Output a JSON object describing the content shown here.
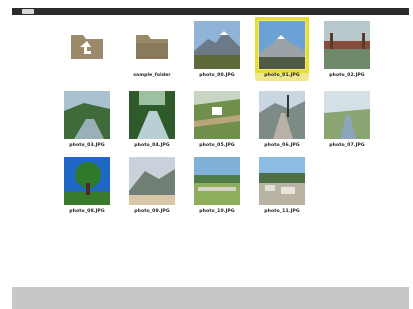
{
  "topbar": {
    "icon": "menu-icon"
  },
  "files": [
    {
      "type": "up-folder",
      "label": "",
      "icon": "up-folder-icon"
    },
    {
      "type": "folder",
      "label": "sample_folder",
      "icon": "folder-icon"
    },
    {
      "type": "photo",
      "label": "photo_00.JPG",
      "scene": "mountain"
    },
    {
      "type": "photo",
      "label": "photo_01.JPG",
      "scene": "mountain-snow",
      "selected": true
    },
    {
      "type": "photo",
      "label": "photo_02.JPG",
      "scene": "bridge"
    },
    {
      "type": "photo",
      "label": "photo_03.JPG",
      "scene": "river"
    },
    {
      "type": "photo",
      "label": "photo_04.JPG",
      "scene": "stream"
    },
    {
      "type": "photo",
      "label": "photo_05.JPG",
      "scene": "terrace"
    },
    {
      "type": "photo",
      "label": "photo_06.JPG",
      "scene": "road"
    },
    {
      "type": "photo",
      "label": "photo_07.JPG",
      "scene": "canal"
    },
    {
      "type": "photo",
      "label": "photo_08.JPG",
      "scene": "tree"
    },
    {
      "type": "photo",
      "label": "photo_09.JPG",
      "scene": "hills"
    },
    {
      "type": "photo",
      "label": "photo_10.JPG",
      "scene": "town"
    },
    {
      "type": "photo",
      "label": "photo_11.JPG",
      "scene": "village"
    }
  ],
  "colors": {
    "folder": "#9a8a6a",
    "selection": "#e7df2a",
    "footer": "#c7c7c7",
    "topbar": "#2b2b2b"
  }
}
